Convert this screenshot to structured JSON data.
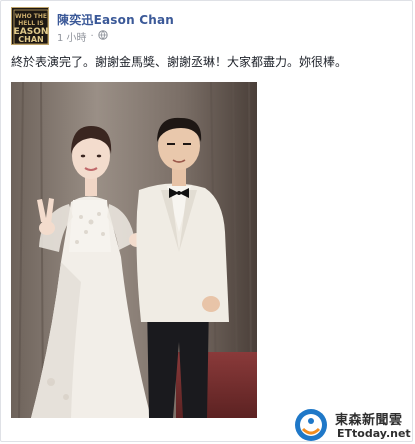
{
  "post": {
    "author_name": "陳奕迅Eason Chan",
    "timestamp": "1 小時",
    "audience_icon": "globe-icon",
    "text": "終於表演完了。謝謝金馬獎、謝謝丞琳！大家都盡力。妳很棒。",
    "photo_subject": "photo"
  },
  "avatar": {
    "lines": [
      "WHO THE",
      "HELL IS",
      "EASON",
      "CHAN"
    ]
  },
  "watermark": {
    "line1": "東森新聞雲",
    "line2": "ETtoday.net"
  },
  "colors": {
    "link": "#3b5998",
    "meta": "#90949c",
    "text": "#1d2129",
    "avatar_bg": "#1d1712",
    "avatar_accent": "#c8a96a"
  }
}
